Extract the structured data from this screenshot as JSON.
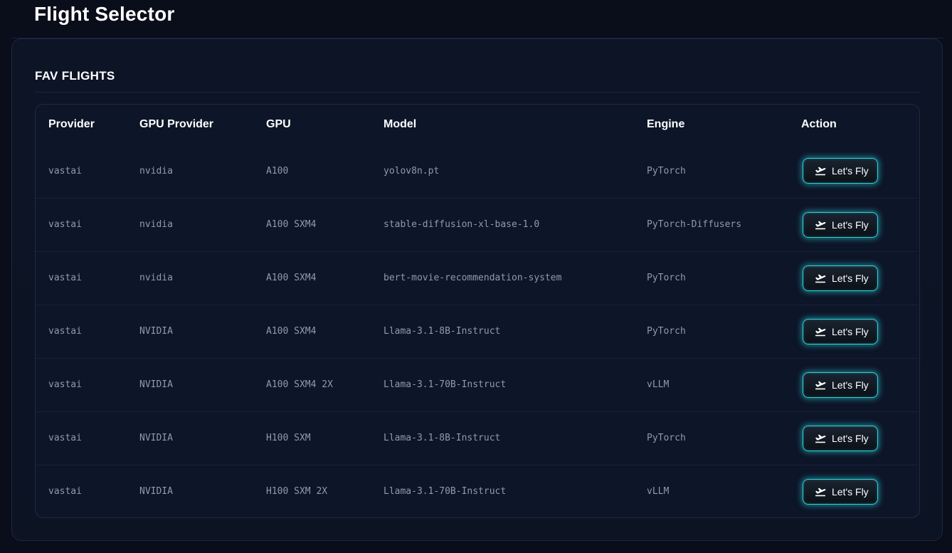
{
  "header": {
    "title": "Flight Selector"
  },
  "card": {
    "title": "FAV FLIGHTS"
  },
  "table": {
    "columns": [
      "Provider",
      "GPU Provider",
      "GPU",
      "Model",
      "Engine",
      "Action"
    ],
    "rows": [
      {
        "provider": "vastai",
        "gpu_provider": "nvidia",
        "gpu": "A100",
        "model": "yolov8n.pt",
        "engine": "PyTorch",
        "action": "Let's Fly"
      },
      {
        "provider": "vastai",
        "gpu_provider": "nvidia",
        "gpu": "A100 SXM4",
        "model": "stable-diffusion-xl-base-1.0",
        "engine": "PyTorch-Diffusers",
        "action": "Let's Fly"
      },
      {
        "provider": "vastai",
        "gpu_provider": "nvidia",
        "gpu": "A100 SXM4",
        "model": "bert-movie-recommendation-system",
        "engine": "PyTorch",
        "action": "Let's Fly"
      },
      {
        "provider": "vastai",
        "gpu_provider": "NVIDIA",
        "gpu": "A100 SXM4",
        "model": "Llama-3.1-8B-Instruct",
        "engine": "PyTorch",
        "action": "Let's Fly"
      },
      {
        "provider": "vastai",
        "gpu_provider": "NVIDIA",
        "gpu": "A100 SXM4 2X",
        "model": "Llama-3.1-70B-Instruct",
        "engine": "vLLM",
        "action": "Let's Fly"
      },
      {
        "provider": "vastai",
        "gpu_provider": "NVIDIA",
        "gpu": "H100 SXM",
        "model": "Llama-3.1-8B-Instruct",
        "engine": "PyTorch",
        "action": "Let's Fly"
      },
      {
        "provider": "vastai",
        "gpu_provider": "NVIDIA",
        "gpu": "H100 SXM 2X",
        "model": "Llama-3.1-70B-Instruct",
        "engine": "vLLM",
        "action": "Let's Fly"
      }
    ]
  },
  "icons": {
    "action_button": "plane-takeoff-icon"
  },
  "colors": {
    "accent_glow": "#2fd3d8",
    "background": "#0a0e1a",
    "card": "#0d1426"
  }
}
